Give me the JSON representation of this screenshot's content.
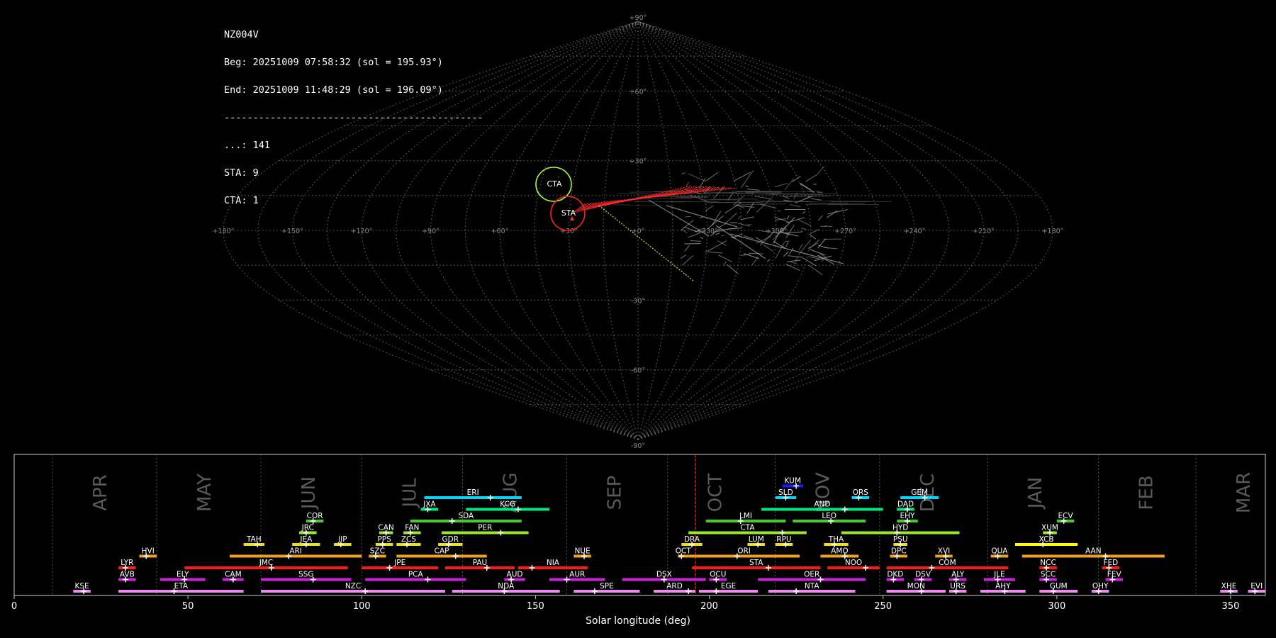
{
  "info": {
    "station": "NZ004V",
    "begin": "Beg: 20251009 07:58:32 (sol = 195.93°)",
    "end": "End: 20251009 11:48:29 (sol = 196.09°)",
    "rule": "---------------------------------------------",
    "count_sporadic": "...: 141",
    "count_sta": "STA: 9",
    "count_cta": "CTA: 1"
  },
  "sky_map": {
    "lat_labels": [
      "+90°",
      "+60°",
      "+30°",
      "-30°",
      "-60°",
      "-90°"
    ],
    "lon_labels": [
      "+180°",
      "+150°",
      "+120°",
      "+90°",
      "+60°",
      "+30°",
      "+0°",
      "+330°",
      "+300°",
      "+270°",
      "+240°",
      "+210°",
      "+180°"
    ],
    "radiants": [
      {
        "label": "CTA",
        "color": "#adff2f"
      },
      {
        "label": "STA",
        "color": "#ff2020"
      }
    ]
  },
  "chart_data": {
    "type": "timeline",
    "xlabel": "Solar longitude (deg)",
    "xlim": [
      0,
      360
    ],
    "x_ticks": [
      0,
      50,
      100,
      150,
      200,
      250,
      300,
      350
    ],
    "current_sol": 196.0,
    "months": [
      {
        "name": "APR",
        "start": 11
      },
      {
        "name": "MAY",
        "start": 41
      },
      {
        "name": "JUN",
        "start": 71
      },
      {
        "name": "JUL",
        "start": 100
      },
      {
        "name": "AUG",
        "start": 129
      },
      {
        "name": "SEP",
        "start": 159
      },
      {
        "name": "OCT",
        "start": 188
      },
      {
        "name": "NOV",
        "start": 219
      },
      {
        "name": "DEC",
        "start": 249
      },
      {
        "name": "JAN",
        "start": 280
      },
      {
        "name": "FEB",
        "start": 312
      },
      {
        "name": "MAR",
        "start": 340
      }
    ],
    "showers": [
      {
        "code": "KUM",
        "start": 221,
        "end": 227,
        "peak": 225,
        "row": 9,
        "color": "#1a1aff"
      },
      {
        "code": "ERI",
        "start": 118,
        "end": 146,
        "peak": 137,
        "row": 8,
        "color": "#00d5ff"
      },
      {
        "code": "SLD",
        "start": 219,
        "end": 225,
        "peak": 222,
        "row": 8,
        "color": "#00d5ff"
      },
      {
        "code": "ORS",
        "start": 241,
        "end": 246,
        "peak": 243,
        "row": 8,
        "color": "#00d5ff"
      },
      {
        "code": "GEM",
        "start": 255,
        "end": 266,
        "peak": 262,
        "row": 8,
        "color": "#00d5ff"
      },
      {
        "code": "JXA",
        "start": 117,
        "end": 122,
        "peak": 119,
        "row": 7,
        "color": "#00e87a"
      },
      {
        "code": "KCG",
        "start": 130,
        "end": 154,
        "peak": 145,
        "row": 7,
        "color": "#00e87a"
      },
      {
        "code": "AND",
        "start": 215,
        "end": 250,
        "peak": 239,
        "row": 7,
        "color": "#00e87a"
      },
      {
        "code": "DAD",
        "start": 254,
        "end": 259,
        "peak": 257,
        "row": 7,
        "color": "#00e87a"
      },
      {
        "code": "COR",
        "start": 84,
        "end": 89,
        "peak": 86,
        "row": 6,
        "color": "#44cc22"
      },
      {
        "code": "SDA",
        "start": 114,
        "end": 146,
        "peak": 126,
        "row": 6,
        "color": "#44cc22"
      },
      {
        "code": "LMI",
        "start": 199,
        "end": 222,
        "peak": 209,
        "row": 6,
        "color": "#44cc22"
      },
      {
        "code": "LEO",
        "start": 224,
        "end": 245,
        "peak": 235,
        "row": 6,
        "color": "#44cc22"
      },
      {
        "code": "EHY",
        "start": 254,
        "end": 260,
        "peak": 257,
        "row": 6,
        "color": "#44cc22"
      },
      {
        "code": "ECV",
        "start": 300,
        "end": 305,
        "peak": 302,
        "row": 6,
        "color": "#44cc22"
      },
      {
        "code": "JRC",
        "start": 82,
        "end": 87,
        "peak": 84,
        "row": 5,
        "color": "#99e82a"
      },
      {
        "code": "CAN",
        "start": 105,
        "end": 109,
        "peak": 107,
        "row": 5,
        "color": "#99e82a"
      },
      {
        "code": "FAN",
        "start": 112,
        "end": 117,
        "peak": 114,
        "row": 5,
        "color": "#99e82a"
      },
      {
        "code": "PER",
        "start": 123,
        "end": 148,
        "peak": 140,
        "row": 5,
        "color": "#99e82a"
      },
      {
        "code": "CTA",
        "start": 194,
        "end": 228,
        "peak": 221,
        "row": 5,
        "color": "#99e82a"
      },
      {
        "code": "HYD",
        "start": 238,
        "end": 272,
        "peak": 254,
        "row": 5,
        "color": "#99e82a"
      },
      {
        "code": "XUM",
        "start": 296,
        "end": 300,
        "peak": 298,
        "row": 5,
        "color": "#99e82a"
      },
      {
        "code": "TAH",
        "start": 66,
        "end": 72,
        "peak": 70,
        "row": 4,
        "color": "#e8e020"
      },
      {
        "code": "JEA",
        "start": 80,
        "end": 88,
        "peak": 84,
        "row": 4,
        "color": "#e8e020"
      },
      {
        "code": "JIP",
        "start": 92,
        "end": 97,
        "peak": 94,
        "row": 4,
        "color": "#e8e020"
      },
      {
        "code": "PPS",
        "start": 104,
        "end": 109,
        "peak": 106,
        "row": 4,
        "color": "#e8e020"
      },
      {
        "code": "ZCS",
        "start": 110,
        "end": 117,
        "peak": 113,
        "row": 4,
        "color": "#e8e020"
      },
      {
        "code": "GDR",
        "start": 122,
        "end": 129,
        "peak": 125,
        "row": 4,
        "color": "#e8e020"
      },
      {
        "code": "DRA",
        "start": 192,
        "end": 198,
        "peak": 195,
        "row": 4,
        "color": "#e8e020"
      },
      {
        "code": "LUM",
        "start": 211,
        "end": 216,
        "peak": 214,
        "row": 4,
        "color": "#e8e020"
      },
      {
        "code": "RPU",
        "start": 219,
        "end": 224,
        "peak": 222,
        "row": 4,
        "color": "#e8e020"
      },
      {
        "code": "THA",
        "start": 233,
        "end": 240,
        "peak": 236,
        "row": 4,
        "color": "#e8e020"
      },
      {
        "code": "PSU",
        "start": 253,
        "end": 257,
        "peak": 255,
        "row": 4,
        "color": "#e8e020"
      },
      {
        "code": "XCB",
        "start": 288,
        "end": 306,
        "peak": 296,
        "row": 4,
        "color": "#ffff00"
      },
      {
        "code": "HVI",
        "start": 36,
        "end": 41,
        "peak": 38,
        "row": 3,
        "color": "#f0a020"
      },
      {
        "code": "ARI",
        "start": 62,
        "end": 100,
        "peak": 79,
        "row": 3,
        "color": "#f0a020"
      },
      {
        "code": "SZC",
        "start": 102,
        "end": 107,
        "peak": 104,
        "row": 3,
        "color": "#f0a020"
      },
      {
        "code": "CAP",
        "start": 110,
        "end": 136,
        "peak": 127,
        "row": 3,
        "color": "#f0a020"
      },
      {
        "code": "NUE",
        "start": 161,
        "end": 166,
        "peak": 164,
        "row": 3,
        "color": "#f0a020"
      },
      {
        "code": "OCT",
        "start": 191,
        "end": 194,
        "peak": 192,
        "row": 3,
        "color": "#f0a020"
      },
      {
        "code": "ORI",
        "start": 194,
        "end": 226,
        "peak": 208,
        "row": 3,
        "color": "#f0a020"
      },
      {
        "code": "AMO",
        "start": 232,
        "end": 243,
        "peak": 239,
        "row": 3,
        "color": "#f0a020"
      },
      {
        "code": "DPC",
        "start": 252,
        "end": 257,
        "peak": 254,
        "row": 3,
        "color": "#f0a020"
      },
      {
        "code": "XVI",
        "start": 265,
        "end": 270,
        "peak": 268,
        "row": 3,
        "color": "#f0a020"
      },
      {
        "code": "QUA",
        "start": 281,
        "end": 286,
        "peak": 283,
        "row": 3,
        "color": "#f0a020"
      },
      {
        "code": "AAN",
        "start": 290,
        "end": 331,
        "peak": 314,
        "row": 3,
        "color": "#f0a020"
      },
      {
        "code": "LYR",
        "start": 30,
        "end": 35,
        "peak": 32,
        "row": 2,
        "color": "#ff1a1a"
      },
      {
        "code": "JMC",
        "start": 49,
        "end": 96,
        "peak": 74,
        "row": 2,
        "color": "#ff1a1a"
      },
      {
        "code": "JPE",
        "start": 100,
        "end": 122,
        "peak": 108,
        "row": 2,
        "color": "#ff1a1a"
      },
      {
        "code": "PAU",
        "start": 124,
        "end": 144,
        "peak": 136,
        "row": 2,
        "color": "#ff1a1a"
      },
      {
        "code": "NIA",
        "start": 145,
        "end": 165,
        "peak": 149,
        "row": 2,
        "color": "#ff1a1a"
      },
      {
        "code": "STA",
        "start": 195,
        "end": 232,
        "peak": 217,
        "row": 2,
        "color": "#ff1a1a"
      },
      {
        "code": "NOO",
        "start": 234,
        "end": 249,
        "peak": 245,
        "row": 2,
        "color": "#ff1a1a"
      },
      {
        "code": "COM",
        "start": 251,
        "end": 286,
        "peak": 264,
        "row": 2,
        "color": "#ff1a1a"
      },
      {
        "code": "NCC",
        "start": 295,
        "end": 300,
        "peak": 297,
        "row": 2,
        "color": "#ff1a1a"
      },
      {
        "code": "FED",
        "start": 313,
        "end": 318,
        "peak": 315,
        "row": 2,
        "color": "#ff1a1a"
      },
      {
        "code": "AVB",
        "start": 30,
        "end": 35,
        "peak": 32,
        "row": 1,
        "color": "#cc22dd"
      },
      {
        "code": "ELY",
        "start": 42,
        "end": 55,
        "peak": 49,
        "row": 1,
        "color": "#cc22dd"
      },
      {
        "code": "CAM",
        "start": 60,
        "end": 66,
        "peak": 63,
        "row": 1,
        "color": "#cc22dd"
      },
      {
        "code": "SSG",
        "start": 71,
        "end": 97,
        "peak": 86,
        "row": 1,
        "color": "#cc22dd"
      },
      {
        "code": "PCA",
        "start": 101,
        "end": 130,
        "peak": 119,
        "row": 1,
        "color": "#cc22dd"
      },
      {
        "code": "AUD",
        "start": 141,
        "end": 147,
        "peak": 143,
        "row": 1,
        "color": "#cc22dd"
      },
      {
        "code": "AUR",
        "start": 154,
        "end": 170,
        "peak": 159,
        "row": 1,
        "color": "#cc22dd"
      },
      {
        "code": "DSX",
        "start": 175,
        "end": 199,
        "peak": 187,
        "row": 1,
        "color": "#cc22dd"
      },
      {
        "code": "OCU",
        "start": 200,
        "end": 205,
        "peak": 202,
        "row": 1,
        "color": "#cc22dd"
      },
      {
        "code": "OER",
        "start": 214,
        "end": 245,
        "peak": 232,
        "row": 1,
        "color": "#cc22dd"
      },
      {
        "code": "DKD",
        "start": 251,
        "end": 256,
        "peak": 253,
        "row": 1,
        "color": "#cc22dd"
      },
      {
        "code": "DSV",
        "start": 259,
        "end": 264,
        "peak": 261,
        "row": 1,
        "color": "#cc22dd"
      },
      {
        "code": "ALY",
        "start": 269,
        "end": 274,
        "peak": 271,
        "row": 1,
        "color": "#cc22dd"
      },
      {
        "code": "JLE",
        "start": 279,
        "end": 288,
        "peak": 283,
        "row": 1,
        "color": "#cc22dd"
      },
      {
        "code": "SCC",
        "start": 295,
        "end": 300,
        "peak": 297,
        "row": 1,
        "color": "#cc22dd"
      },
      {
        "code": "FEV",
        "start": 314,
        "end": 319,
        "peak": 316,
        "row": 1,
        "color": "#cc22dd"
      },
      {
        "code": "KSE",
        "start": 17,
        "end": 22,
        "peak": 20,
        "row": 0,
        "color": "#ee88ee"
      },
      {
        "code": "ETA",
        "start": 30,
        "end": 66,
        "peak": 46,
        "row": 0,
        "color": "#ee88ee"
      },
      {
        "code": "NZC",
        "start": 71,
        "end": 124,
        "peak": 101,
        "row": 0,
        "color": "#ee88ee"
      },
      {
        "code": "NDA",
        "start": 126,
        "end": 157,
        "peak": 141,
        "row": 0,
        "color": "#ee88ee"
      },
      {
        "code": "SPE",
        "start": 161,
        "end": 180,
        "peak": 167,
        "row": 0,
        "color": "#ee88ee"
      },
      {
        "code": "ARD",
        "start": 184,
        "end": 196,
        "peak": 194,
        "row": 0,
        "color": "#ee88ee"
      },
      {
        "code": "EGE",
        "start": 197,
        "end": 214,
        "peak": 202,
        "row": 0,
        "color": "#ee88ee"
      },
      {
        "code": "NTA",
        "start": 217,
        "end": 242,
        "peak": 225,
        "row": 0,
        "color": "#ee88ee"
      },
      {
        "code": "MON",
        "start": 251,
        "end": 268,
        "peak": 261,
        "row": 0,
        "color": "#ee88ee"
      },
      {
        "code": "URS",
        "start": 269,
        "end": 274,
        "peak": 271,
        "row": 0,
        "color": "#ee88ee"
      },
      {
        "code": "AHY",
        "start": 278,
        "end": 291,
        "peak": 285,
        "row": 0,
        "color": "#ee88ee"
      },
      {
        "code": "GUM",
        "start": 295,
        "end": 306,
        "peak": 299,
        "row": 0,
        "color": "#ee88ee"
      },
      {
        "code": "OHY",
        "start": 310,
        "end": 315,
        "peak": 312,
        "row": 0,
        "color": "#ee88ee"
      },
      {
        "code": "XHE",
        "start": 347,
        "end": 352,
        "peak": 350,
        "row": 0,
        "color": "#ee88ee"
      },
      {
        "code": "EVI",
        "start": 355,
        "end": 360,
        "peak": 357,
        "row": 0,
        "color": "#ee88ee"
      }
    ]
  }
}
